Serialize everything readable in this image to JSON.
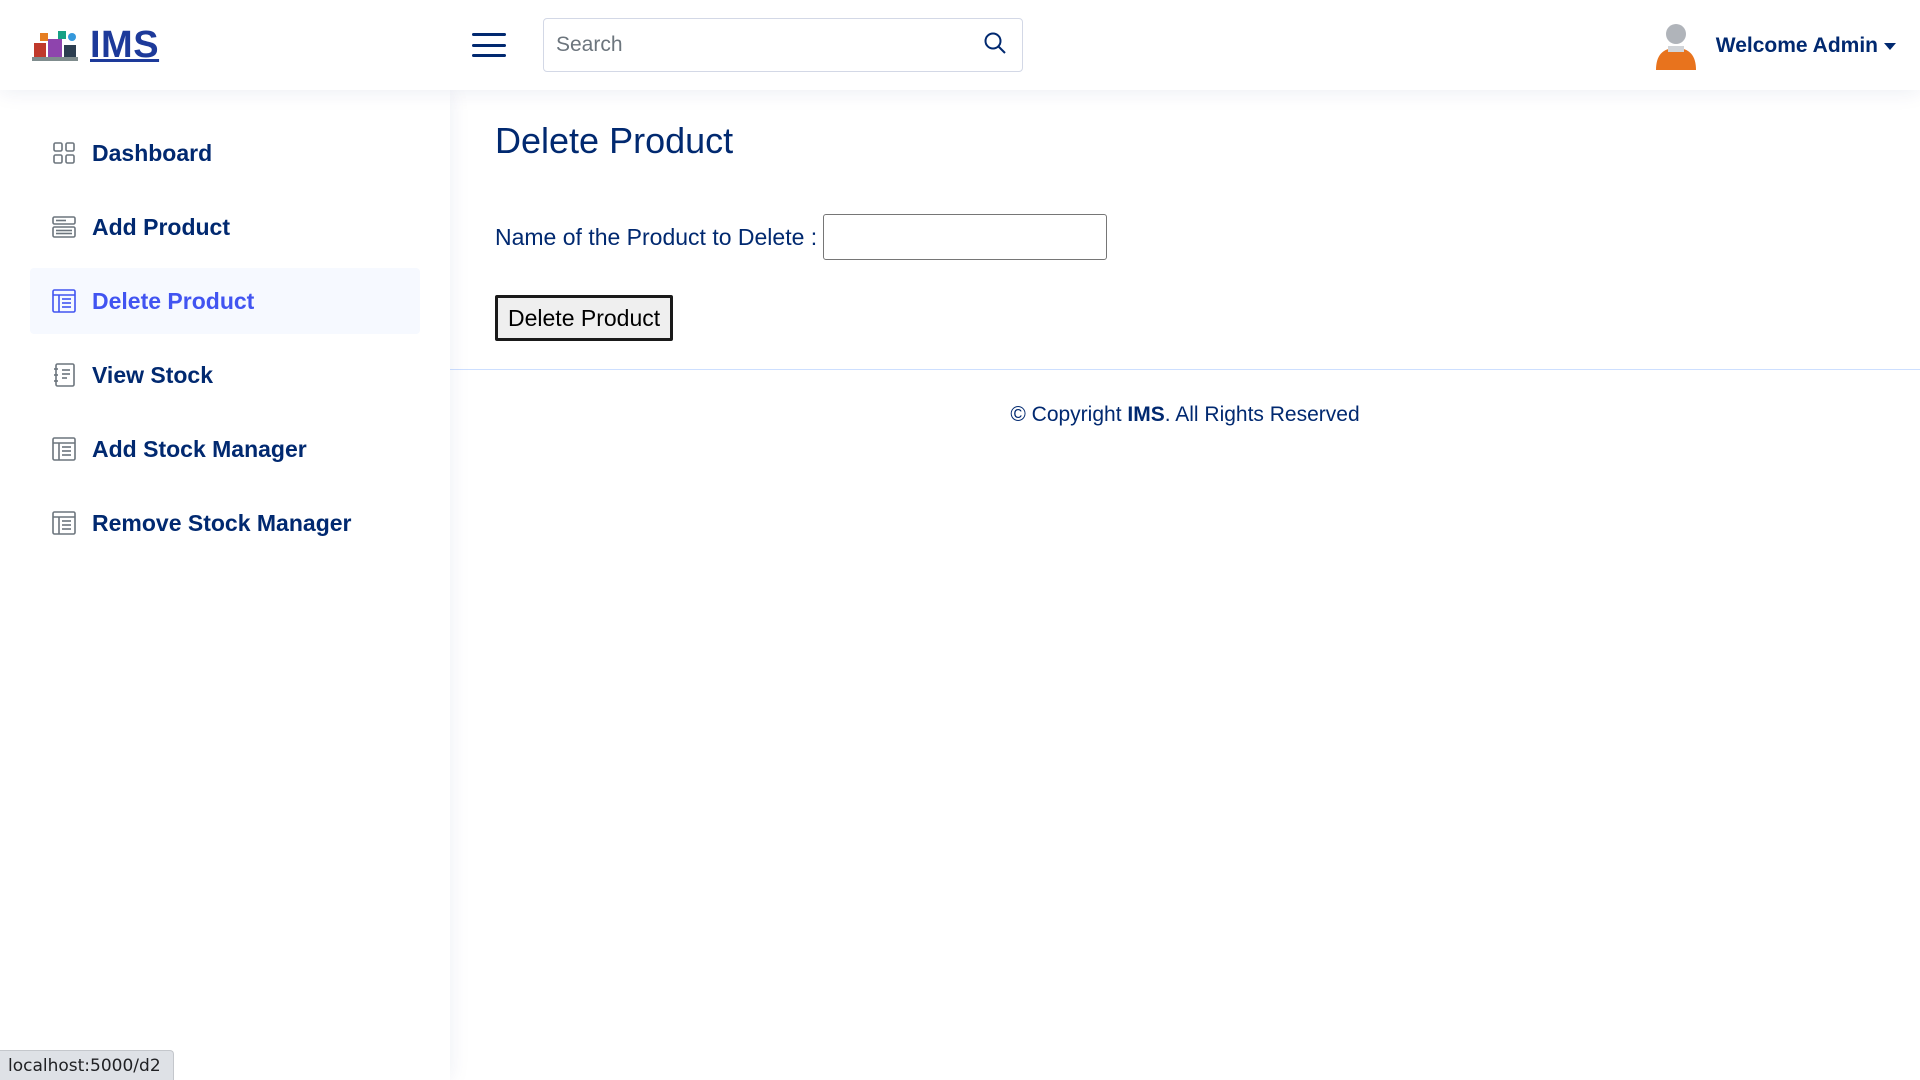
{
  "header": {
    "logo_text": "IMS",
    "search_placeholder": "Search",
    "welcome_text": "Welcome Admin"
  },
  "sidebar": {
    "items": [
      {
        "label": "Dashboard",
        "icon": "grid-icon",
        "active": false
      },
      {
        "label": "Add Product",
        "icon": "menu-button-icon",
        "active": false
      },
      {
        "label": "Delete Product",
        "icon": "layout-text-window-icon",
        "active": true
      },
      {
        "label": "View Stock",
        "icon": "journal-text-icon",
        "active": false
      },
      {
        "label": "Add Stock Manager",
        "icon": "layout-text-window-icon",
        "active": false
      },
      {
        "label": "Remove Stock Manager",
        "icon": "layout-text-window-icon",
        "active": false
      }
    ]
  },
  "main": {
    "title": "Delete Product",
    "field_label": "Name of the Product to Delete :",
    "field_value": "",
    "submit_label": "Delete Product"
  },
  "footer": {
    "prefix": "© Copyright ",
    "brand": "IMS",
    "suffix": ". All Rights Reserved"
  },
  "statusbar": {
    "url": "localhost:5000/d2"
  },
  "colors": {
    "primary": "#012970",
    "accent": "#4154f1",
    "active_bg": "#f6f9ff",
    "avatar_orange": "#e8731d"
  }
}
